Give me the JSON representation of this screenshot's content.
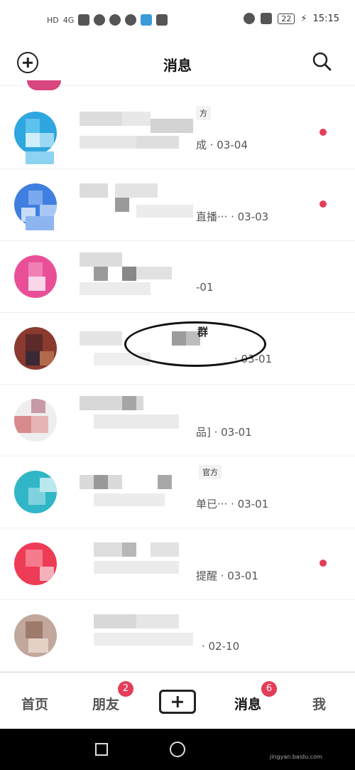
{
  "status_bar": {
    "left_tag": "HD",
    "network": "4G",
    "battery": "22",
    "time": "15:15"
  },
  "header": {
    "title": "消息"
  },
  "rows": [
    {
      "tag": "方",
      "sub": "成 · 03-04",
      "unread": true
    },
    {
      "tag": "",
      "sub": "直播···   · 03-03",
      "unread": true
    },
    {
      "tag": "",
      "sub": "-01",
      "unread": false
    },
    {
      "tag": "",
      "name": "群",
      "sub": "·   03-01",
      "unread": false
    },
    {
      "tag": "",
      "sub": "品] · 03-01",
      "unread": false
    },
    {
      "tag": "官方",
      "sub": "单已···   · 03-01",
      "unread": false
    },
    {
      "tag": "",
      "sub": "提醒 · 03-01",
      "unread": true
    },
    {
      "tag": "",
      "sub": "· 02-10",
      "unread": false
    }
  ],
  "bottom_nav": {
    "home": "首页",
    "friends": "朋友",
    "friends_badge": "2",
    "messages": "消息",
    "messages_badge": "6",
    "me": "我"
  },
  "watermark": "jingyan.baidu.com",
  "colors": {
    "accent": "#e33d5a"
  }
}
